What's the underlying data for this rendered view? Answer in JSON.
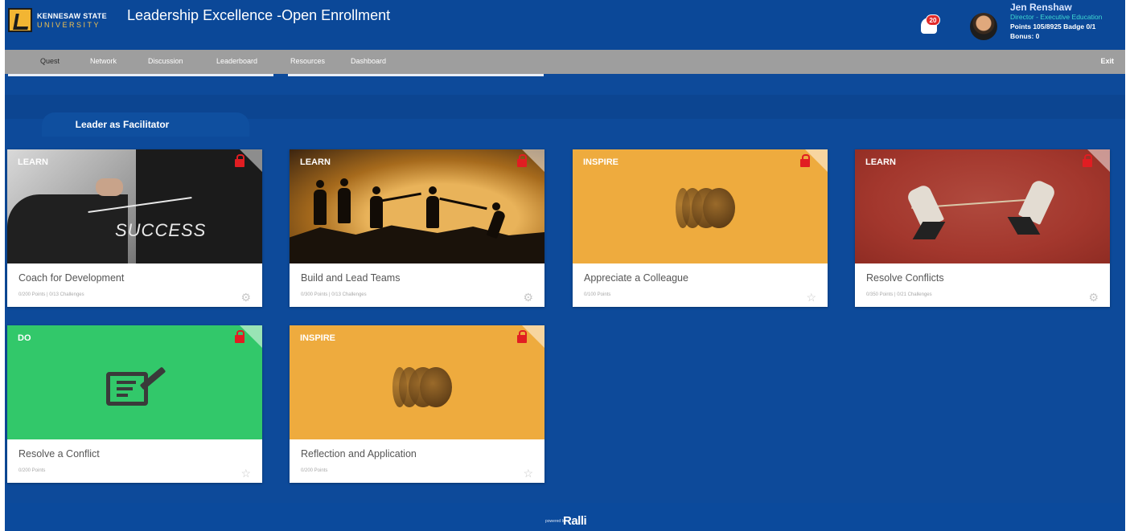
{
  "brand": {
    "logo_line1": "KENNESAW STATE",
    "logo_line2": "UNIVERSITY",
    "accent_gold": "#f2b533",
    "primary_blue": "#0d4a9a"
  },
  "header": {
    "title": "Leadership Excellence -Open Enrollment",
    "notification_count": "20",
    "user": {
      "name": "Jen Renshaw",
      "role": "Director - Executive Education",
      "points": "Points 105/8925 Badge 0/1",
      "bonus": "Bonus: 0"
    }
  },
  "nav": {
    "items": [
      {
        "label": "Quest",
        "active": true
      },
      {
        "label": "Network",
        "active": false
      },
      {
        "label": "Discussion",
        "active": false
      },
      {
        "label": "Leaderboard",
        "active": false
      },
      {
        "label": "Resources",
        "active": false
      },
      {
        "label": "Dashboard",
        "active": false
      }
    ],
    "exit_label": "Exit"
  },
  "section": {
    "title": "Leader as Facilitator"
  },
  "cards": [
    {
      "tag": "LEARN",
      "title": "Coach for Development",
      "meta": "0/200 Points | 0/13 Challenges",
      "locked": true,
      "icon": "gear-icon",
      "image": "success-chalkboard"
    },
    {
      "tag": "LEARN",
      "title": "Build and Lead Teams",
      "meta": "0/300 Points | 0/13 Challenges",
      "locked": true,
      "icon": "gear-icon",
      "image": "team-climbing-silhouette"
    },
    {
      "tag": "INSPIRE",
      "title": "Appreciate a Colleague",
      "meta": "0/100 Points",
      "locked": true,
      "icon": "star-icon",
      "image": "drum-icon"
    },
    {
      "tag": "LEARN",
      "title": "Resolve Conflicts",
      "meta": "0/350 Points | 0/21 Challenges",
      "locked": true,
      "icon": "gear-icon",
      "image": "tug-of-war"
    },
    {
      "tag": "DO",
      "title": "Resolve a Conflict",
      "meta": "0/200 Points",
      "locked": true,
      "icon": "star-icon",
      "image": "edit-document-icon"
    },
    {
      "tag": "INSPIRE",
      "title": "Reflection and Application",
      "meta": "0/200 Points",
      "locked": true,
      "icon": "star-icon",
      "image": "drum-icon"
    }
  ],
  "footer": {
    "powered_by": "powered by",
    "brand": "Ralli"
  }
}
